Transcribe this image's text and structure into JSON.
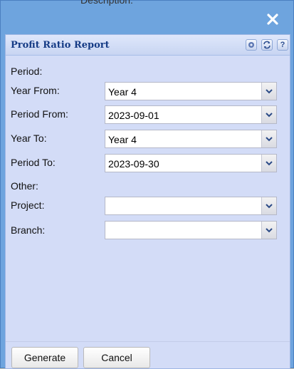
{
  "background": {
    "partial_text": "Description:"
  },
  "window": {
    "close_icon": "close-icon"
  },
  "panel": {
    "title": "Profit Ratio Report",
    "tools": [
      "gear-icon",
      "refresh-icon",
      "help-icon"
    ],
    "help_glyph": "?"
  },
  "form": {
    "period_section": "Period:",
    "year_from": {
      "label": "Year From:",
      "value": "Year 4"
    },
    "period_from": {
      "label": "Period From:",
      "value": "2023-09-01"
    },
    "year_to": {
      "label": "Year To:",
      "value": "Year 4"
    },
    "period_to": {
      "label": "Period To:",
      "value": "2023-09-30"
    },
    "other_section": "Other:",
    "project": {
      "label": "Project:",
      "value": ""
    },
    "branch": {
      "label": "Branch:",
      "value": ""
    }
  },
  "footer": {
    "generate_label": "Generate",
    "cancel_label": "Cancel"
  },
  "colors": {
    "window": "#6ea4de",
    "panel": "#d3dcf7",
    "title": "#153b85"
  }
}
